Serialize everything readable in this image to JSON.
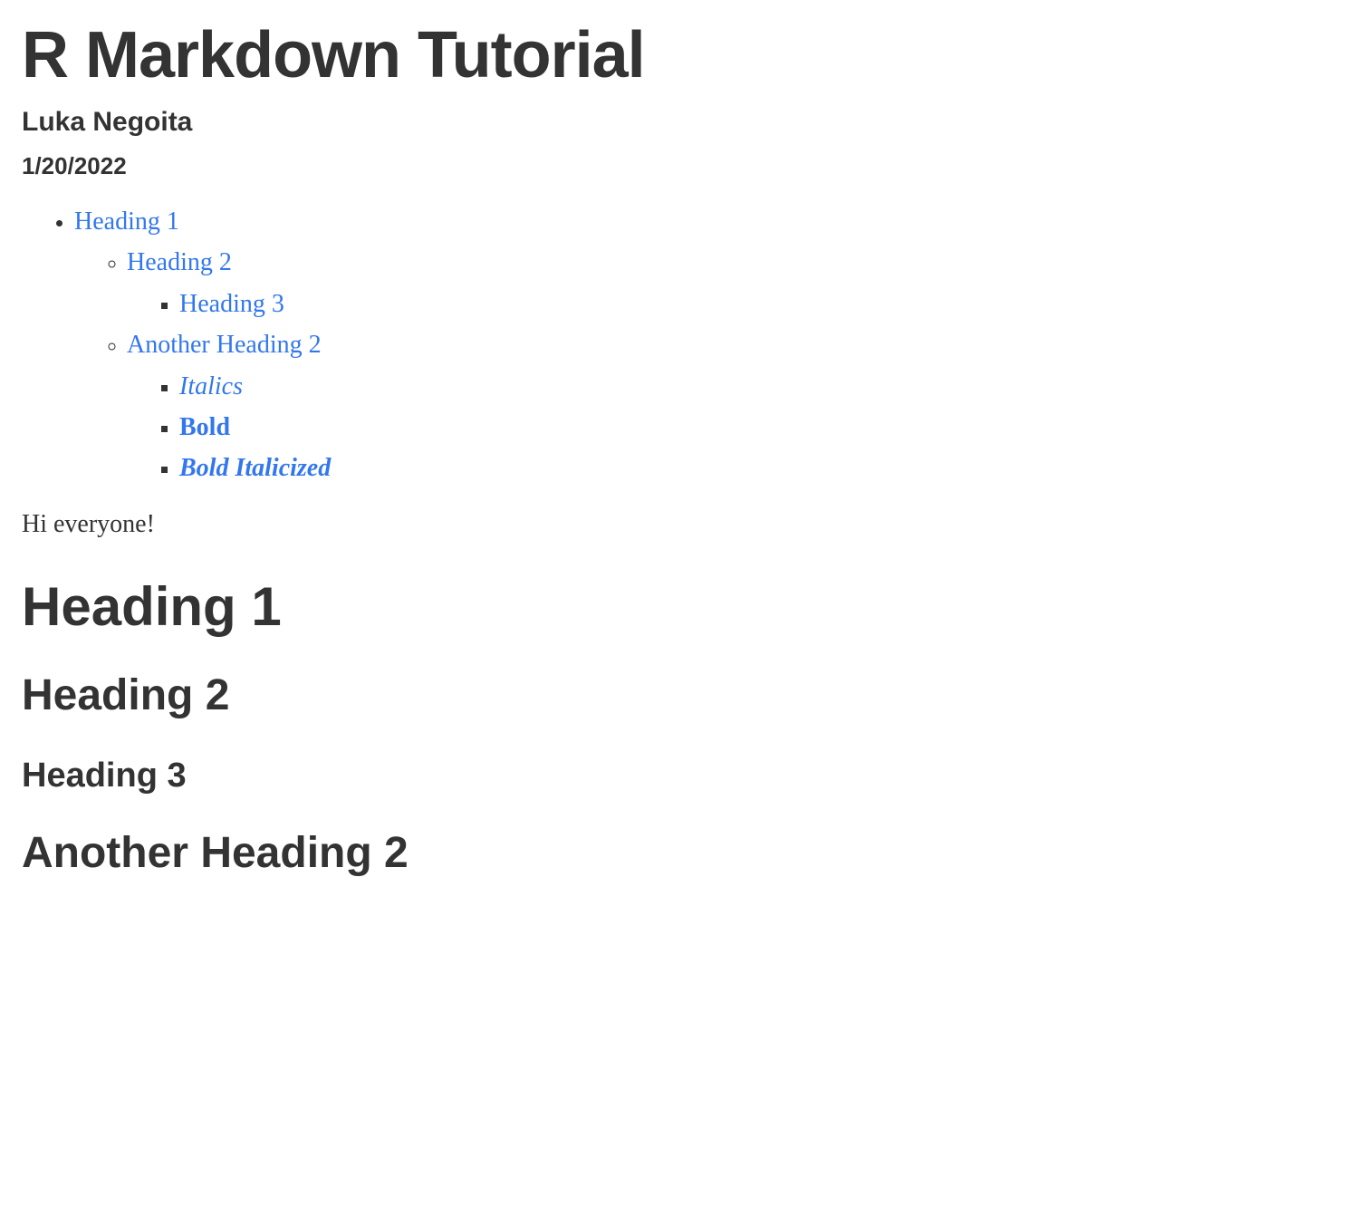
{
  "header": {
    "title": "R Markdown Tutorial",
    "author": "Luka Negoita",
    "date": "1/20/2022"
  },
  "toc": {
    "h1": "Heading 1",
    "h2a": "Heading 2",
    "h3a": "Heading 3",
    "h2b": "Another Heading 2",
    "h3b": "Italics",
    "h3c": "Bold",
    "h3d": "Bold Italicized"
  },
  "body": {
    "intro": "Hi everyone!"
  },
  "sections": {
    "s1": "Heading 1",
    "s2": "Heading 2",
    "s3": "Heading 3",
    "s4": "Another Heading 2"
  }
}
